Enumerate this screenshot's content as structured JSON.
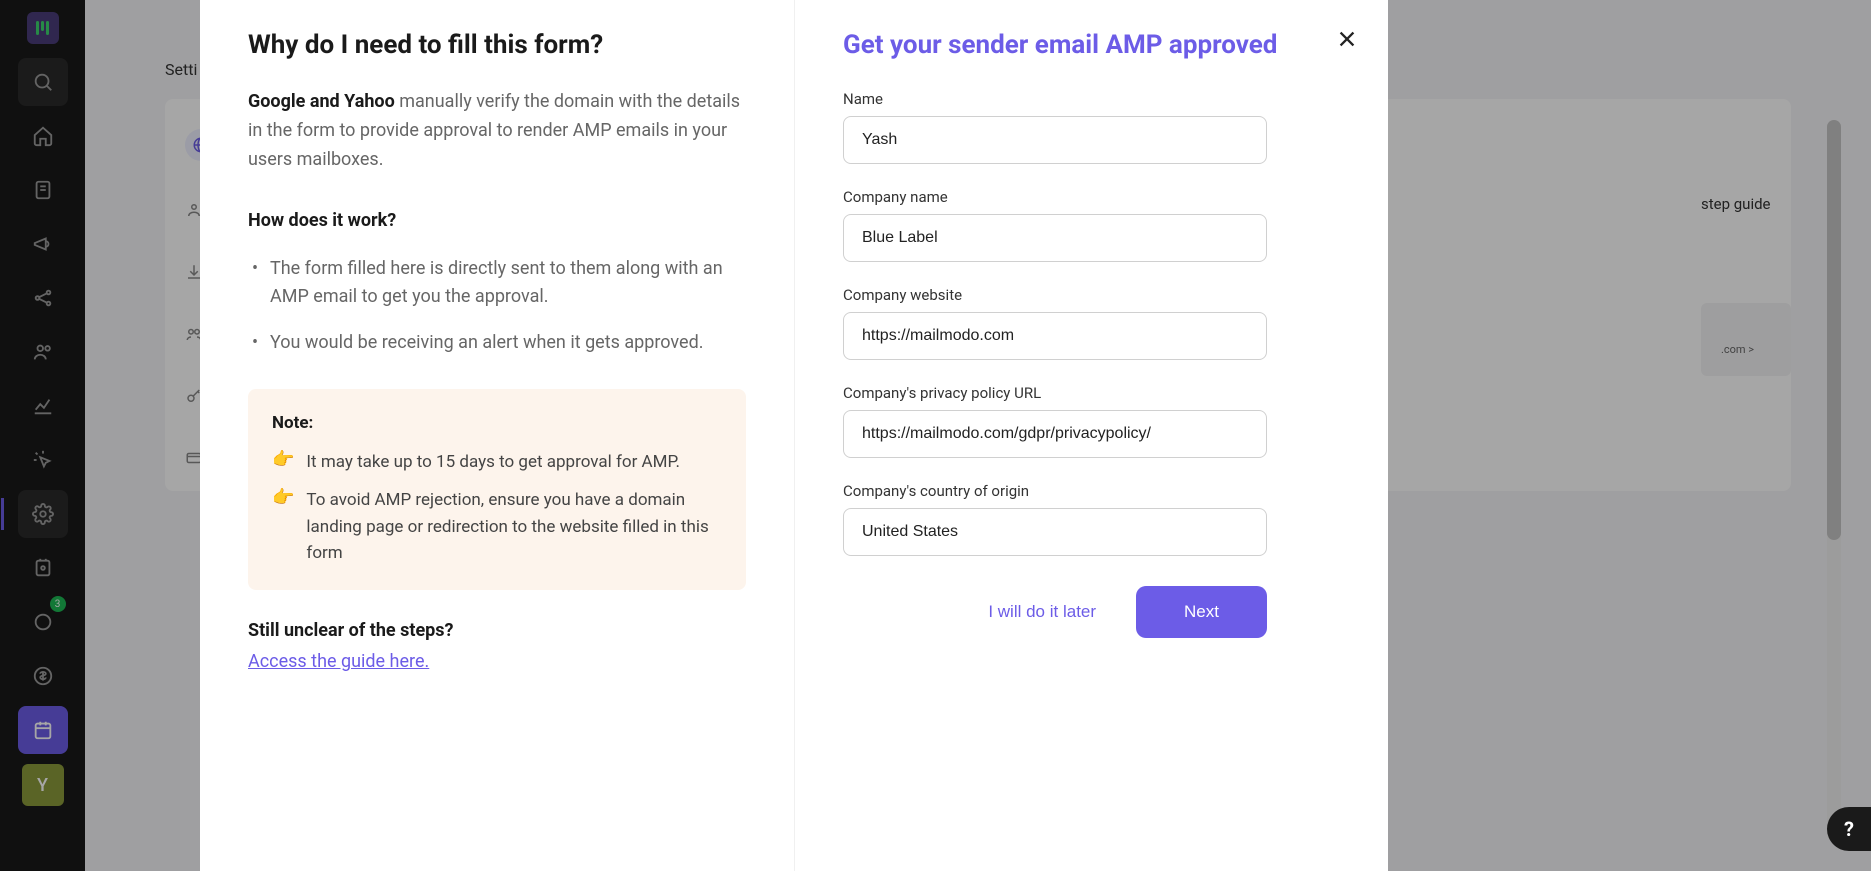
{
  "sidebar": {
    "badge": "3",
    "avatar_letter": "Y"
  },
  "background": {
    "breadcrumb": "Setti",
    "guide_label": "step guide",
    "snippet": ".com >"
  },
  "modal": {
    "left": {
      "title": "Why do I need to fill this form?",
      "intro_strong": "Google and Yahoo",
      "intro_rest": " manually verify the domain with the details in the form to provide approval to render AMP emails in your users mailboxes.",
      "how_title": "How does it work?",
      "bullets": [
        "The form filled here is directly sent to them along with an AMP email to get you the approval.",
        "You would be receiving an alert when it gets approved."
      ],
      "note_title": "Note:",
      "notes": [
        "It may take up to 15 days to get approval for AMP.",
        "To avoid AMP rejection, ensure you have a domain landing page or redirection to the website filled in this form"
      ],
      "unclear": "Still unclear of the steps?",
      "guide_link": "Access the guide here."
    },
    "right": {
      "title": "Get your sender email AMP approved",
      "fields": {
        "name": {
          "label": "Name",
          "value": "Yash"
        },
        "company": {
          "label": "Company name",
          "value": "Blue Label"
        },
        "website": {
          "label": "Company website",
          "value": "https://mailmodo.com"
        },
        "privacy": {
          "label": "Company's privacy policy URL",
          "value": "https://mailmodo.com/gdpr/privacypolicy/"
        },
        "country": {
          "label": "Company's country of origin",
          "value": "United States"
        }
      },
      "actions": {
        "later": "I will do it later",
        "next": "Next"
      }
    }
  },
  "help": "?"
}
